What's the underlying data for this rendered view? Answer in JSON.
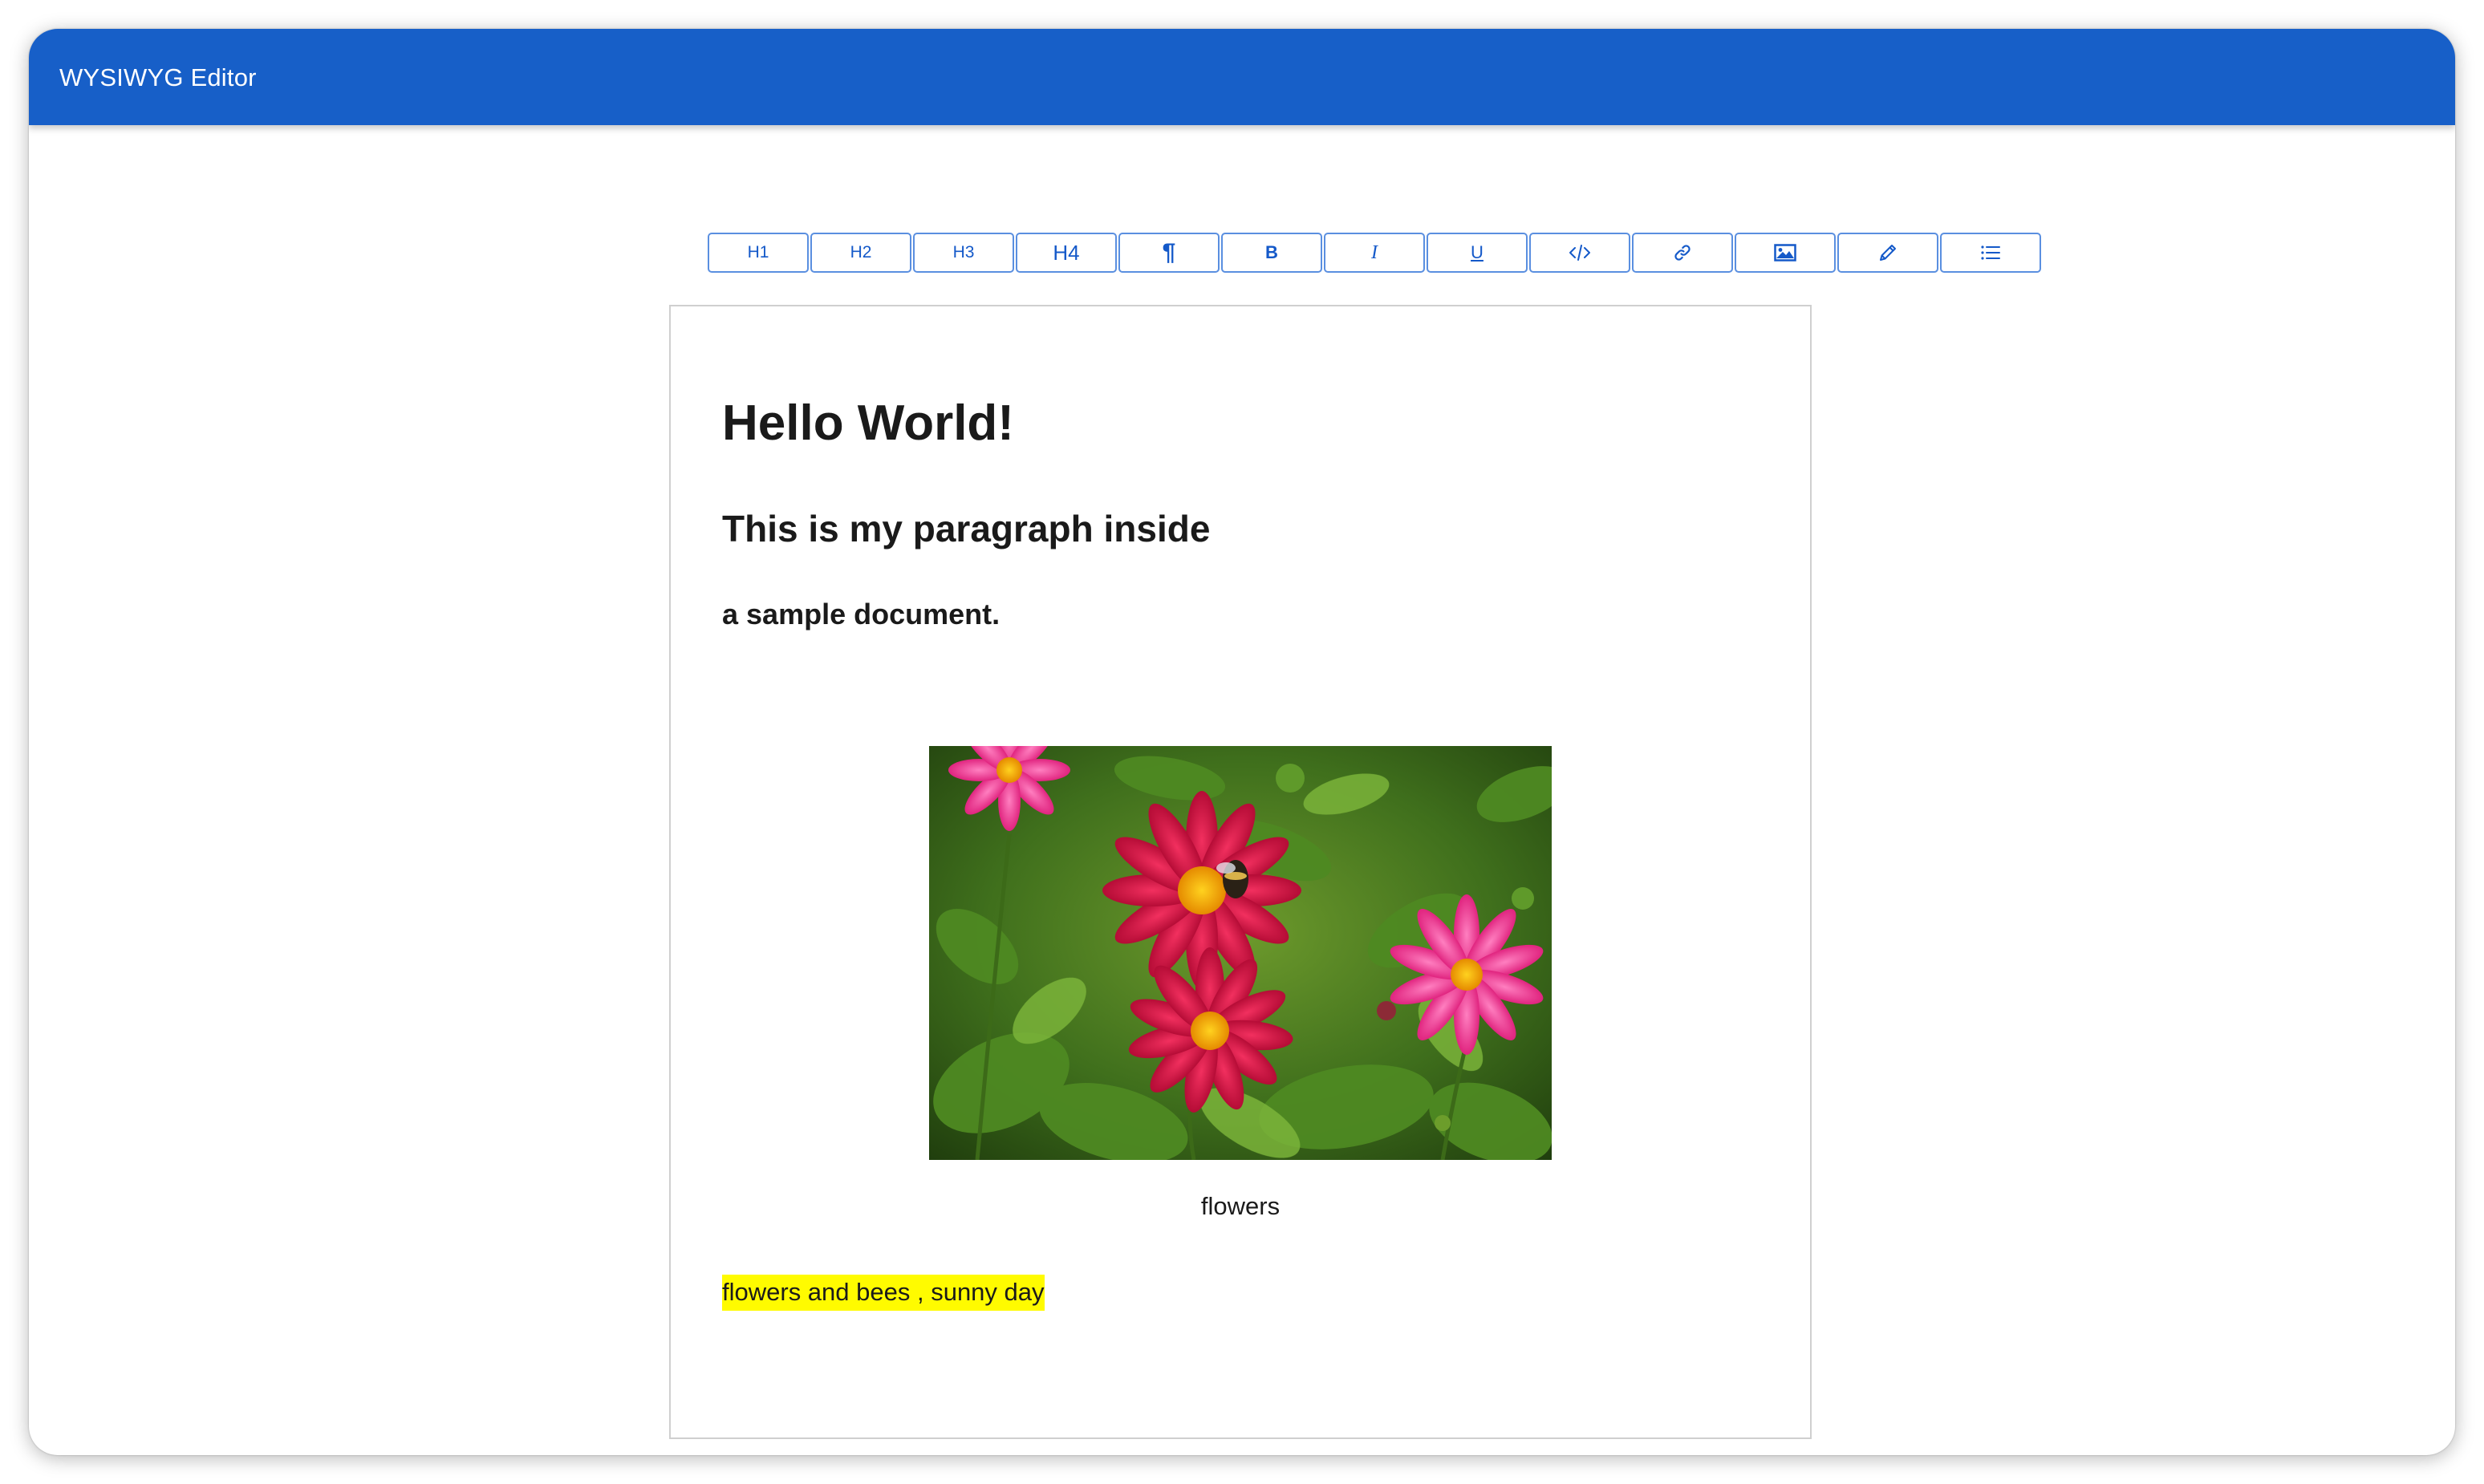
{
  "app": {
    "title": "WYSIWYG Editor"
  },
  "toolbar": {
    "buttons": [
      {
        "label": "H1",
        "icon": "heading-1"
      },
      {
        "label": "H2",
        "icon": "heading-2"
      },
      {
        "label": "H3",
        "icon": "heading-3"
      },
      {
        "label": "H4",
        "icon": "heading-4"
      },
      {
        "label": "¶",
        "icon": "paragraph-icon"
      },
      {
        "label": "B",
        "icon": "bold-icon"
      },
      {
        "label": "I",
        "icon": "italic-icon"
      },
      {
        "label": "U",
        "icon": "underline-icon"
      },
      {
        "label": "",
        "icon": "code-icon"
      },
      {
        "label": "",
        "icon": "link-icon"
      },
      {
        "label": "",
        "icon": "image-icon"
      },
      {
        "label": "",
        "icon": "pencil-icon"
      },
      {
        "label": "",
        "icon": "list-icon"
      }
    ]
  },
  "document": {
    "heading1": "Hello World!",
    "heading2": "This is my paragraph inside",
    "heading3": "a sample document.",
    "image": {
      "alt": "flowers",
      "caption": "flowers",
      "subject": "pink and red dahlia flowers with a bee"
    },
    "highlighted_text": "flowers  and bees , sunny day"
  },
  "colors": {
    "appbar": "#175fc8",
    "toolbar_border": "#5a8fe0",
    "toolbar_text": "#1459c9",
    "highlight": "#fffb00"
  }
}
